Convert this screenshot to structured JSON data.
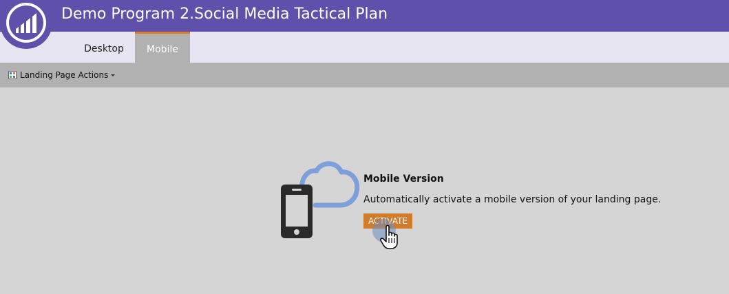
{
  "app": {
    "title": "Demo Program 2.Social Media Tactical Plan",
    "logo_icon": "marketo-logo-icon"
  },
  "tabs": [
    {
      "label": "Desktop",
      "active": false
    },
    {
      "label": "Mobile",
      "active": true
    }
  ],
  "toolbar": {
    "actions_label": "Landing Page Actions",
    "actions_icon": "grid-page-icon",
    "dropdown_icon": "caret-down-icon"
  },
  "mobile_panel": {
    "title": "Mobile Version",
    "description": "Automatically activate a mobile version of your landing page.",
    "button_label": "ACTIVATE",
    "illustration": "phone-cloud-icon",
    "cursor": "hand-pointer-icon"
  },
  "colors": {
    "header_bg": "#5f51ab",
    "tabbar_bg": "#e7e5f2",
    "toolbar_bg": "#b2b1b1",
    "content_bg": "#d6d5d6",
    "accent": "#e07a24",
    "button_bg": "#d17c2a",
    "cloud": "#7f9fdb",
    "phone": "#2a2a2a"
  }
}
